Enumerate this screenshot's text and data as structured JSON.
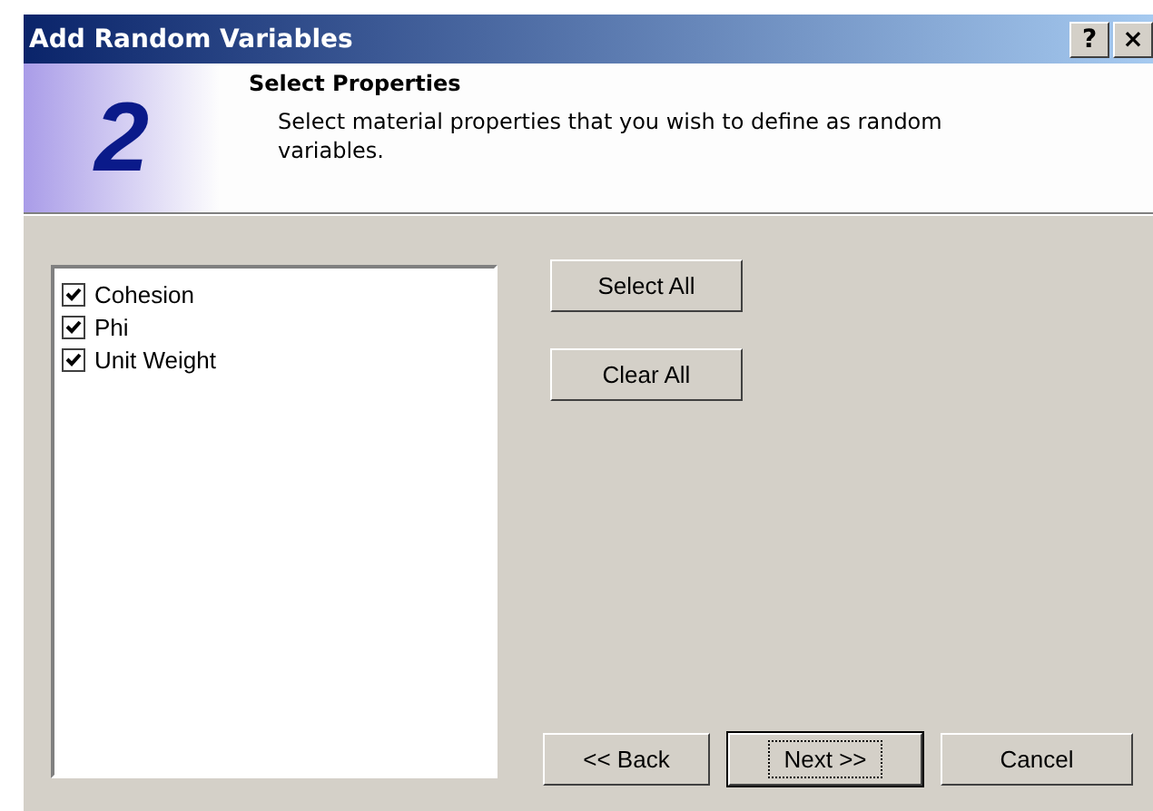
{
  "window": {
    "title": "Add Random Variables",
    "help_button": "?",
    "close_button": "×"
  },
  "header": {
    "step": "2",
    "title": "Select Properties",
    "description": "Select material properties that you wish to define as random variables."
  },
  "properties": [
    {
      "label": "Cohesion",
      "checked": true
    },
    {
      "label": "Phi",
      "checked": true
    },
    {
      "label": "Unit Weight",
      "checked": true
    }
  ],
  "side_buttons": [
    "Select All",
    "Clear All"
  ],
  "footer_buttons": [
    {
      "label": "<< Back",
      "default": false
    },
    {
      "label": "Next >>",
      "default": true
    },
    {
      "label": "Cancel",
      "default": false
    }
  ]
}
